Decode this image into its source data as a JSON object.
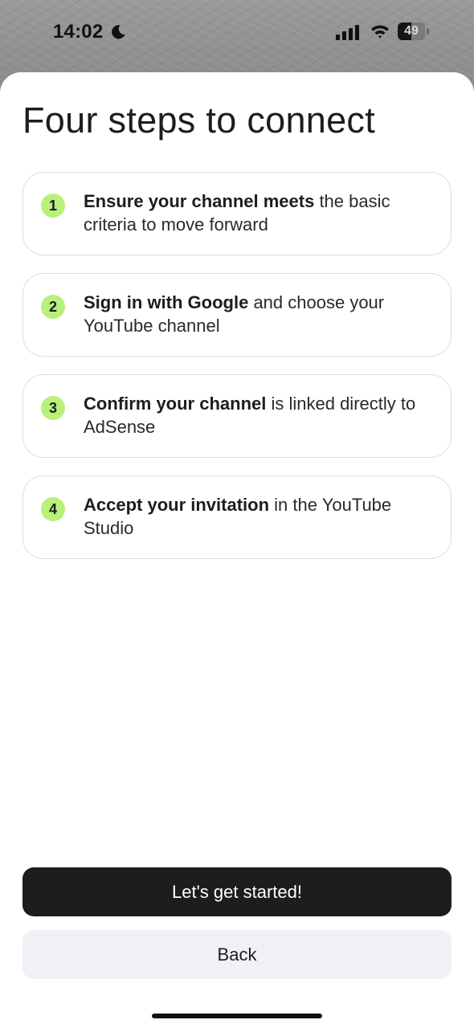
{
  "status_bar": {
    "time": "14:02",
    "battery_level": "49",
    "icons": [
      "moon-icon",
      "signal-icon",
      "wifi-icon",
      "battery-icon"
    ]
  },
  "title": "Four steps to connect",
  "steps": [
    {
      "number": "1",
      "bold": "Ensure your channel meets",
      "rest": " the basic criteria to move forward"
    },
    {
      "number": "2",
      "bold": "Sign in with Google",
      "rest": " and choose your YouTube channel"
    },
    {
      "number": "3",
      "bold": "Confirm your channel",
      "rest": " is linked directly to AdSense"
    },
    {
      "number": "4",
      "bold": "Accept your invitation",
      "rest": " in the YouTube Studio"
    }
  ],
  "buttons": {
    "primary_label": "Let's get started!",
    "secondary_label": "Back"
  },
  "colors": {
    "accent": "#b8f07a",
    "primary_button": "#1d1d20",
    "secondary_button": "#eff1f7"
  }
}
